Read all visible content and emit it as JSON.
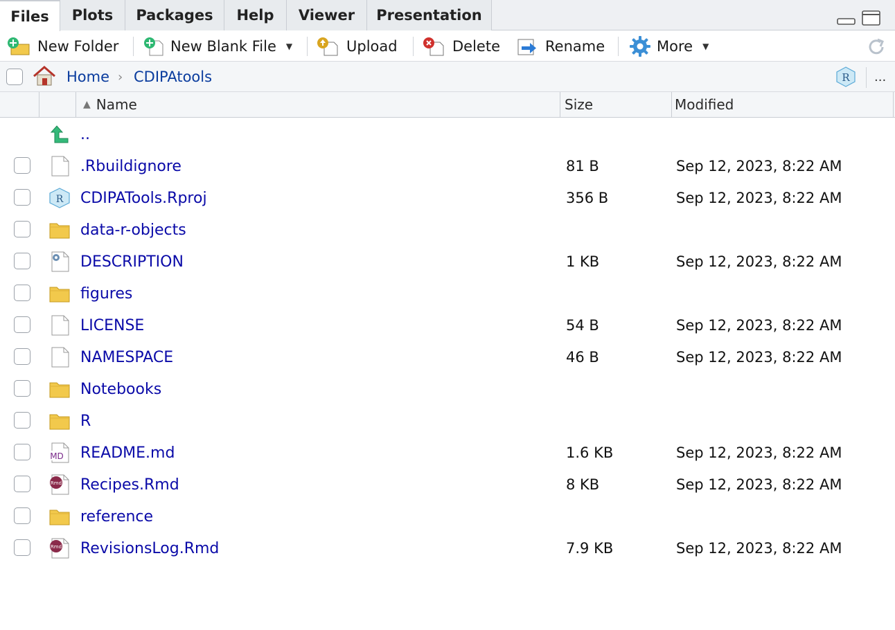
{
  "tabs": [
    {
      "label": "Files",
      "active": true
    },
    {
      "label": "Plots"
    },
    {
      "label": "Packages"
    },
    {
      "label": "Help"
    },
    {
      "label": "Viewer"
    },
    {
      "label": "Presentation"
    }
  ],
  "toolbar": {
    "new_folder": "New Folder",
    "new_blank_file": "New Blank File",
    "upload": "Upload",
    "delete": "Delete",
    "rename": "Rename",
    "more": "More"
  },
  "breadcrumb": {
    "home": "Home",
    "current": "CDIPAtools",
    "more": "..."
  },
  "columns": {
    "name": "Name",
    "size": "Size",
    "modified": "Modified"
  },
  "parent_dir": "..",
  "files": [
    {
      "name": ".Rbuildignore",
      "size": "81 B",
      "modified": "Sep 12, 2023, 8:22 AM",
      "icon": "file-icon"
    },
    {
      "name": "CDIPATools.Rproj",
      "size": "356 B",
      "modified": "Sep 12, 2023, 8:22 AM",
      "icon": "rproj-icon"
    },
    {
      "name": "data-r-objects",
      "size": "",
      "modified": "",
      "icon": "folder-icon"
    },
    {
      "name": "DESCRIPTION",
      "size": "1 KB",
      "modified": "Sep 12, 2023, 8:22 AM",
      "icon": "description-icon"
    },
    {
      "name": "figures",
      "size": "",
      "modified": "",
      "icon": "folder-icon"
    },
    {
      "name": "LICENSE",
      "size": "54 B",
      "modified": "Sep 12, 2023, 8:22 AM",
      "icon": "file-icon"
    },
    {
      "name": "NAMESPACE",
      "size": "46 B",
      "modified": "Sep 12, 2023, 8:22 AM",
      "icon": "file-icon"
    },
    {
      "name": "Notebooks",
      "size": "",
      "modified": "",
      "icon": "folder-icon"
    },
    {
      "name": "R",
      "size": "",
      "modified": "",
      "icon": "folder-icon"
    },
    {
      "name": "README.md",
      "size": "1.6 KB",
      "modified": "Sep 12, 2023, 8:22 AM",
      "icon": "markdown-icon"
    },
    {
      "name": "Recipes.Rmd",
      "size": "8 KB",
      "modified": "Sep 12, 2023, 8:22 AM",
      "icon": "rmd-icon"
    },
    {
      "name": "reference",
      "size": "",
      "modified": "",
      "icon": "folder-icon"
    },
    {
      "name": "RevisionsLog.Rmd",
      "size": "7.9 KB",
      "modified": "Sep 12, 2023, 8:22 AM",
      "icon": "rmd-icon"
    }
  ],
  "icon_labels": {
    "markdown": "MD",
    "rmd": "Rmd",
    "rproj": "R"
  },
  "colors": {
    "link": "#0a0aa8",
    "breadcrumb_link": "#0a3c9e",
    "folder": "#f2c94c",
    "rmd_badge": "#8a2a4a",
    "markdown_badge": "#7a2a8a"
  }
}
